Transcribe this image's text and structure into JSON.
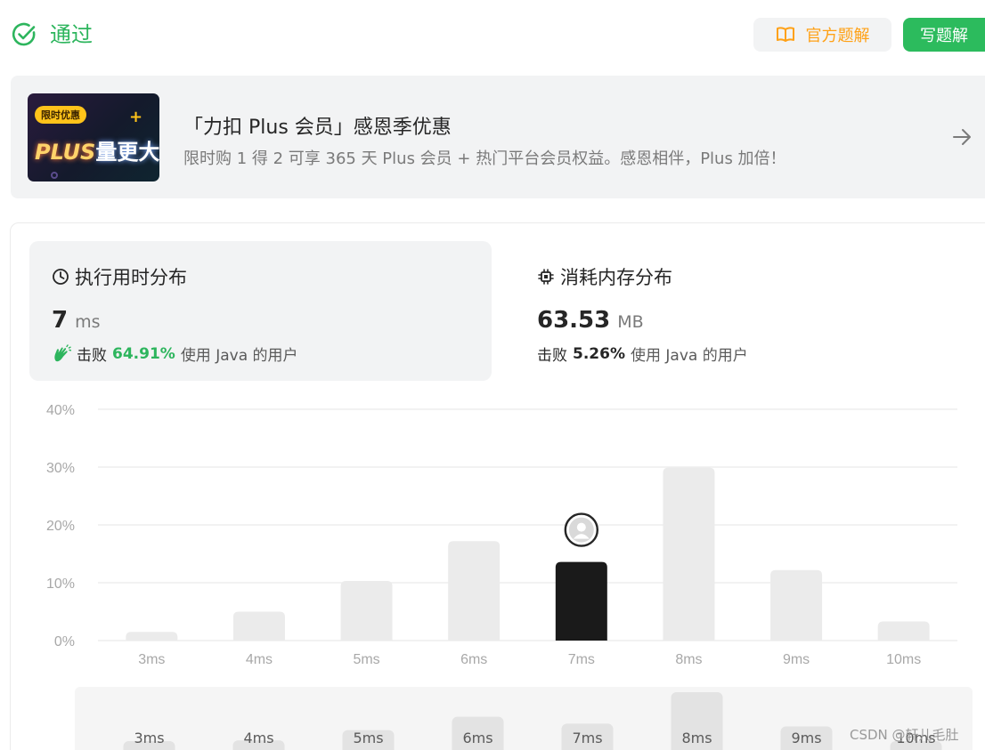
{
  "header": {
    "status": "通过",
    "solution_button": "官方题解",
    "write_button": "写题解",
    "colors": {
      "accepted": "#2db55d",
      "solution": "#ffa116",
      "write_bg": "#2cbb5d"
    }
  },
  "promo": {
    "badge": "限时优惠",
    "brand_prefix": "PLUS",
    "brand_suffix": "量更大",
    "title": "「力扣 Plus 会员」感恩季优惠",
    "subtitle": "限时购 1 得 2 可享 365 天 Plus 会员 + 热门平台会员权益。感恩相伴，Plus 加倍！",
    "arrow_icon": "arrow-right-icon"
  },
  "runtime": {
    "title": "执行用时分布",
    "value": "7",
    "unit": "ms",
    "beat_label": "击败",
    "beat_pct": "64.91%",
    "beat_suffix": "使用 Java 的用户",
    "icon": "clock-icon"
  },
  "memory": {
    "title": "消耗内存分布",
    "value": "63.53",
    "unit": "MB",
    "beat_label": "击败",
    "beat_pct": "5.26%",
    "beat_suffix": "使用 Java 的用户",
    "icon": "chip-icon"
  },
  "chart_data": {
    "type": "bar",
    "title": "",
    "xlabel": "",
    "ylabel": "",
    "categories": [
      "3ms",
      "4ms",
      "5ms",
      "6ms",
      "7ms",
      "8ms",
      "9ms",
      "10ms"
    ],
    "values": [
      1.5,
      5,
      10.3,
      17.2,
      13.6,
      29.9,
      12.2,
      3.3
    ],
    "ylim": [
      0,
      40
    ],
    "yticks": [
      "0%",
      "10%",
      "20%",
      "30%",
      "40%"
    ],
    "highlight": "7ms",
    "grid": true,
    "colors": {
      "bar": "#ebebeb",
      "highlight": "#1a1a1a",
      "grid": "#ebebeb",
      "tick": "#a8a8a8"
    }
  },
  "range_chart": {
    "categories": [
      "3ms",
      "4ms",
      "5ms",
      "6ms",
      "7ms",
      "8ms",
      "9ms",
      "10ms"
    ],
    "values": [
      1.5,
      5,
      10.3,
      17.2,
      13.6,
      29.9,
      12.2,
      3.3
    ]
  },
  "watermark": "CSDN @轩儿毛肚"
}
